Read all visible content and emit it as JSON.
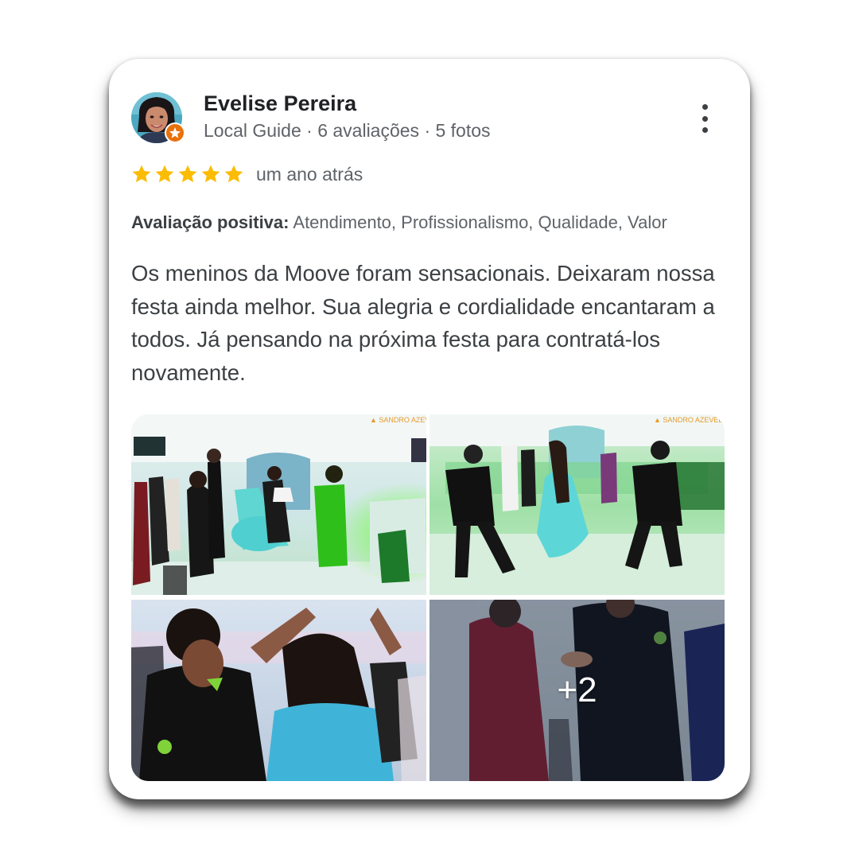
{
  "review": {
    "user": {
      "name": "Evelise Pereira",
      "meta": "Local Guide · 6 avaliações · 5 fotos",
      "badge_icon": "local-guide-star-icon",
      "badge_color": "#e8710a"
    },
    "rating": {
      "value": 5,
      "max": 5,
      "star_color": "#fbbc04"
    },
    "date": "um ano atrás",
    "positive": {
      "label": "Avaliação positiva:",
      "items": "Atendimento, Profissionalismo, Qualidade, Valor"
    },
    "text": "Os meninos da Moove foram sensacionais. Deixaram nossa festa ainda melhor. Sua alegria e cordialidade encantaram a todos. Já pensando na próxima festa para contratá-los novamente.",
    "photos": {
      "count_shown": 4,
      "more_label": "+2"
    },
    "menu_icon": "more-vert-icon"
  }
}
